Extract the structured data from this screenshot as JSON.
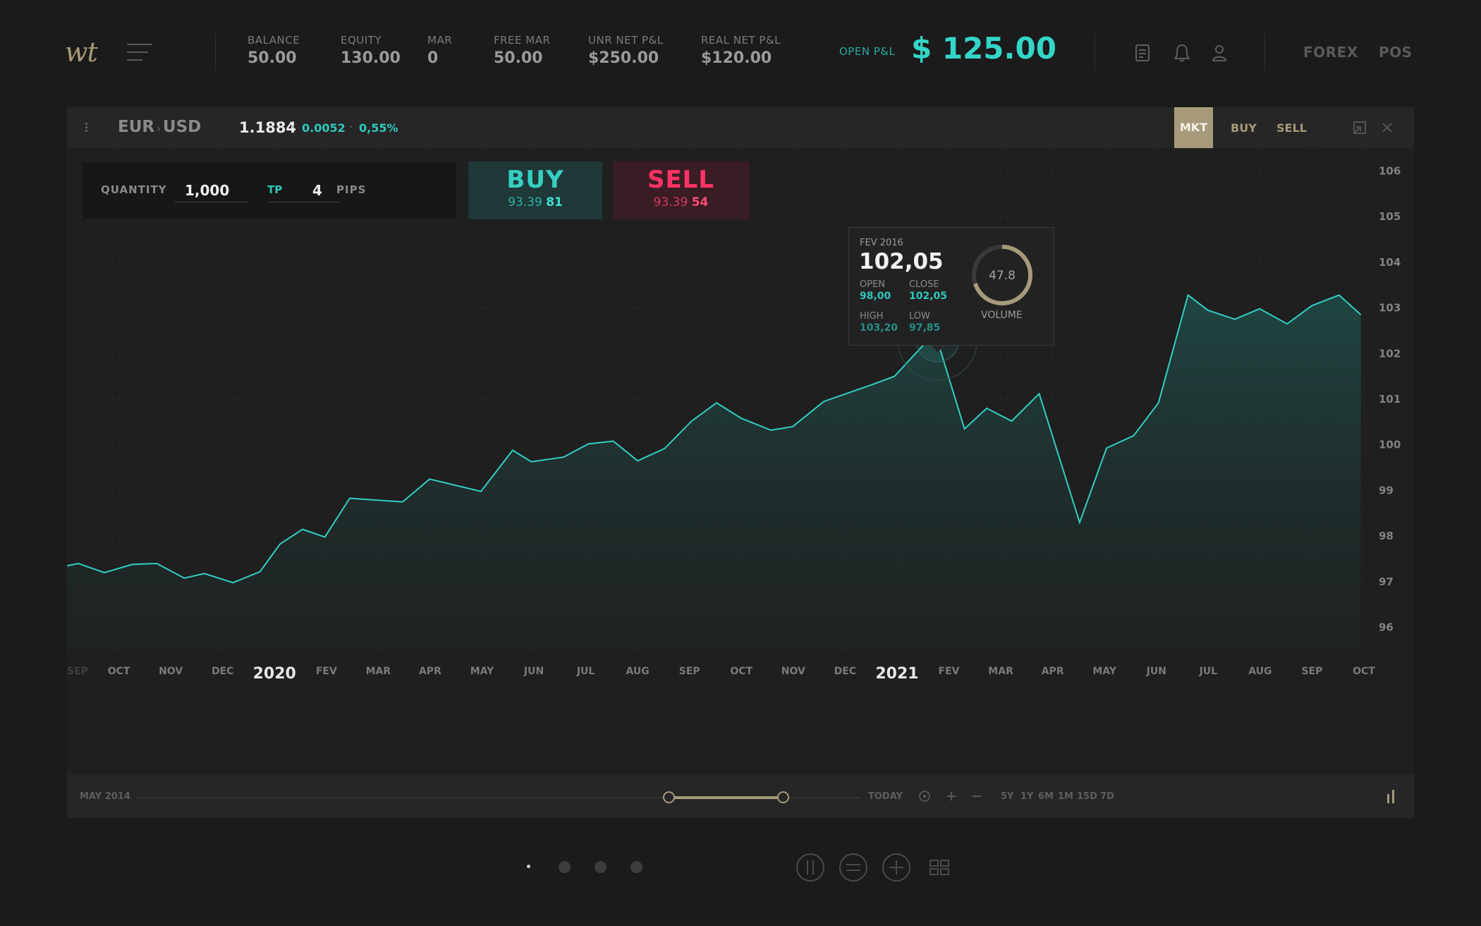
{
  "header": {
    "logo": "wt",
    "stats": [
      {
        "label": "BALANCE",
        "value": "50.00"
      },
      {
        "label": "EQUITY",
        "value": "130.00"
      },
      {
        "label": "MAR",
        "value": "0"
      },
      {
        "label": "FREE MAR",
        "value": "50.00"
      },
      {
        "label": "UNR NET P&L",
        "value": "$250.00"
      },
      {
        "label": "REAL NET P&L",
        "value": "$120.00"
      }
    ],
    "open_pl_label": "OPEN P&L",
    "open_pl_value": "$ 125.00",
    "nav": [
      "FOREX",
      "POS"
    ]
  },
  "panel": {
    "pair_base": "EUR",
    "pair_arrow": "›",
    "pair_quote": "USD",
    "price": "1.1884",
    "separator": "·",
    "change": "0.0052",
    "change_pct": "0,55%",
    "tabs": {
      "mkt": "MKT",
      "buy": "BUY",
      "sell": "SELL"
    }
  },
  "order": {
    "quantity_label": "QUANTITY",
    "quantity_value": "1,000",
    "tp_label": "TP",
    "tp_value": "4",
    "pips_label": "PIPS",
    "buy": {
      "label": "BUY",
      "price_main": "93.39",
      "price_pip": "81"
    },
    "sell": {
      "label": "SELL",
      "price_main": "93.39",
      "price_pip": "54"
    }
  },
  "tooltip": {
    "date": "FEV 2016",
    "value": "102,05",
    "open_label": "OPEN",
    "open_value": "98,00",
    "close_label": "CLOSE",
    "close_value": "102,05",
    "high_label": "HIGH",
    "high_value": "103,20",
    "low_label": "LOW",
    "low_value": "97,85",
    "volume_value": "47.8",
    "volume_label": "VOLUME",
    "volume_fraction": 0.7
  },
  "range": {
    "start_label": "MAY 2014",
    "today_label": "TODAY",
    "periods": [
      "5Y",
      "1Y",
      "6M",
      "1M",
      "15D",
      "7D"
    ]
  },
  "pager": {
    "count": 4,
    "active": 0
  },
  "colors": {
    "accent": "#33d6c8",
    "sell": "#ff3366",
    "gold": "#a69a7a"
  },
  "chart_data": {
    "type": "area",
    "ylim": [
      95.5,
      106.5
    ],
    "y_ticks": [
      96,
      97,
      98,
      99,
      100,
      101,
      102,
      103,
      104,
      105,
      106
    ],
    "x_labels": [
      {
        "label": "SEP",
        "t": 0
      },
      {
        "label": "OCT",
        "t": 1
      },
      {
        "label": "NOV",
        "t": 2
      },
      {
        "label": "DEC",
        "t": 3
      },
      {
        "label": "2020",
        "t": 4,
        "year": true
      },
      {
        "label": "FEV",
        "t": 5
      },
      {
        "label": "MAR",
        "t": 6
      },
      {
        "label": "APR",
        "t": 7
      },
      {
        "label": "MAY",
        "t": 8
      },
      {
        "label": "JUN",
        "t": 9
      },
      {
        "label": "JUL",
        "t": 10
      },
      {
        "label": "AUG",
        "t": 11
      },
      {
        "label": "SEP",
        "t": 12
      },
      {
        "label": "OCT",
        "t": 13
      },
      {
        "label": "NOV",
        "t": 14
      },
      {
        "label": "DEC",
        "t": 15
      },
      {
        "label": "2021",
        "t": 16,
        "year": true
      },
      {
        "label": "FEV",
        "t": 17
      },
      {
        "label": "MAR",
        "t": 18
      },
      {
        "label": "APR",
        "t": 19
      },
      {
        "label": "MAY",
        "t": 20
      },
      {
        "label": "JUN",
        "t": 21
      },
      {
        "label": "JUL",
        "t": 22
      },
      {
        "label": "AUG",
        "t": 23
      },
      {
        "label": "SEP",
        "t": 24
      },
      {
        "label": "OCT",
        "t": 25
      }
    ],
    "points": [
      [
        0.0,
        97.35
      ],
      [
        0.22,
        97.4
      ],
      [
        0.72,
        97.2
      ],
      [
        1.26,
        97.38
      ],
      [
        1.73,
        97.4
      ],
      [
        2.26,
        97.08
      ],
      [
        2.65,
        97.18
      ],
      [
        3.2,
        96.98
      ],
      [
        3.72,
        97.22
      ],
      [
        4.11,
        97.83
      ],
      [
        4.54,
        98.15
      ],
      [
        4.97,
        97.98
      ],
      [
        5.45,
        98.83
      ],
      [
        6.47,
        98.75
      ],
      [
        6.99,
        99.25
      ],
      [
        7.98,
        98.98
      ],
      [
        8.59,
        99.88
      ],
      [
        8.95,
        99.63
      ],
      [
        9.57,
        99.73
      ],
      [
        10.05,
        100.02
      ],
      [
        10.53,
        100.08
      ],
      [
        11.0,
        99.65
      ],
      [
        11.52,
        99.92
      ],
      [
        12.04,
        100.52
      ],
      [
        12.52,
        100.92
      ],
      [
        13.0,
        100.58
      ],
      [
        13.57,
        100.32
      ],
      [
        13.99,
        100.4
      ],
      [
        14.59,
        100.95
      ],
      [
        15.52,
        101.32
      ],
      [
        15.95,
        101.5
      ],
      [
        16.52,
        102.2
      ],
      [
        16.78,
        102.28
      ],
      [
        17.3,
        100.35
      ],
      [
        17.73,
        100.8
      ],
      [
        18.21,
        100.52
      ],
      [
        18.74,
        101.12
      ],
      [
        19.52,
        98.3
      ],
      [
        20.04,
        99.93
      ],
      [
        20.56,
        100.2
      ],
      [
        21.04,
        100.92
      ],
      [
        21.61,
        103.28
      ],
      [
        21.99,
        102.95
      ],
      [
        22.51,
        102.75
      ],
      [
        22.99,
        102.98
      ],
      [
        23.52,
        102.65
      ],
      [
        24.0,
        103.05
      ],
      [
        24.52,
        103.28
      ],
      [
        24.94,
        102.85
      ]
    ],
    "highlight_index": 32,
    "grid": true
  }
}
